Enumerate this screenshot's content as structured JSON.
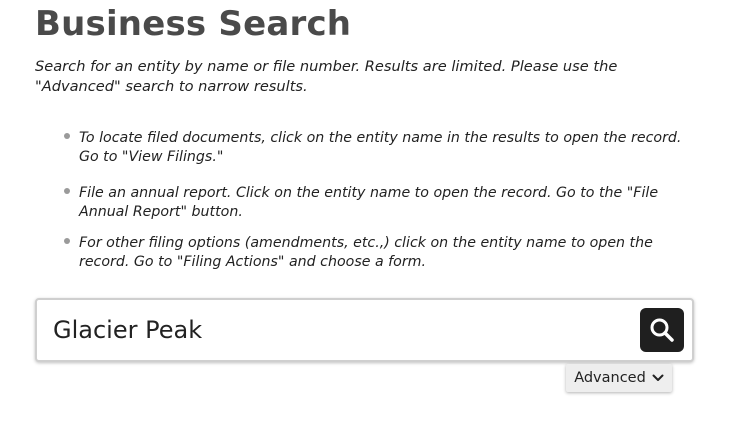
{
  "page": {
    "title": "Business Search",
    "intro": "Search for an entity by name or file number. Results are limited. Please use the \"Advanced\" search to narrow results."
  },
  "tips": [
    "To locate filed documents, click on the entity name in the results to open the record. Go to \"View Filings.\"",
    "File an annual report. Click on the entity name to open the record. Go to the \"File Annual Report\" button.",
    "For other filing options (amendments, etc.,) click on the entity name to open the record. Go to \"Filing Actions\" and choose a form."
  ],
  "search": {
    "value": "Glacier Peak",
    "button_icon": "search-icon"
  },
  "advanced": {
    "label": "Advanced",
    "icon": "chevron-down-icon"
  },
  "colors": {
    "title": "#4a4a4a",
    "search_button": "#1f1f1f",
    "advanced_bg": "#eeeeee",
    "bullet": "#9a9a9a"
  }
}
